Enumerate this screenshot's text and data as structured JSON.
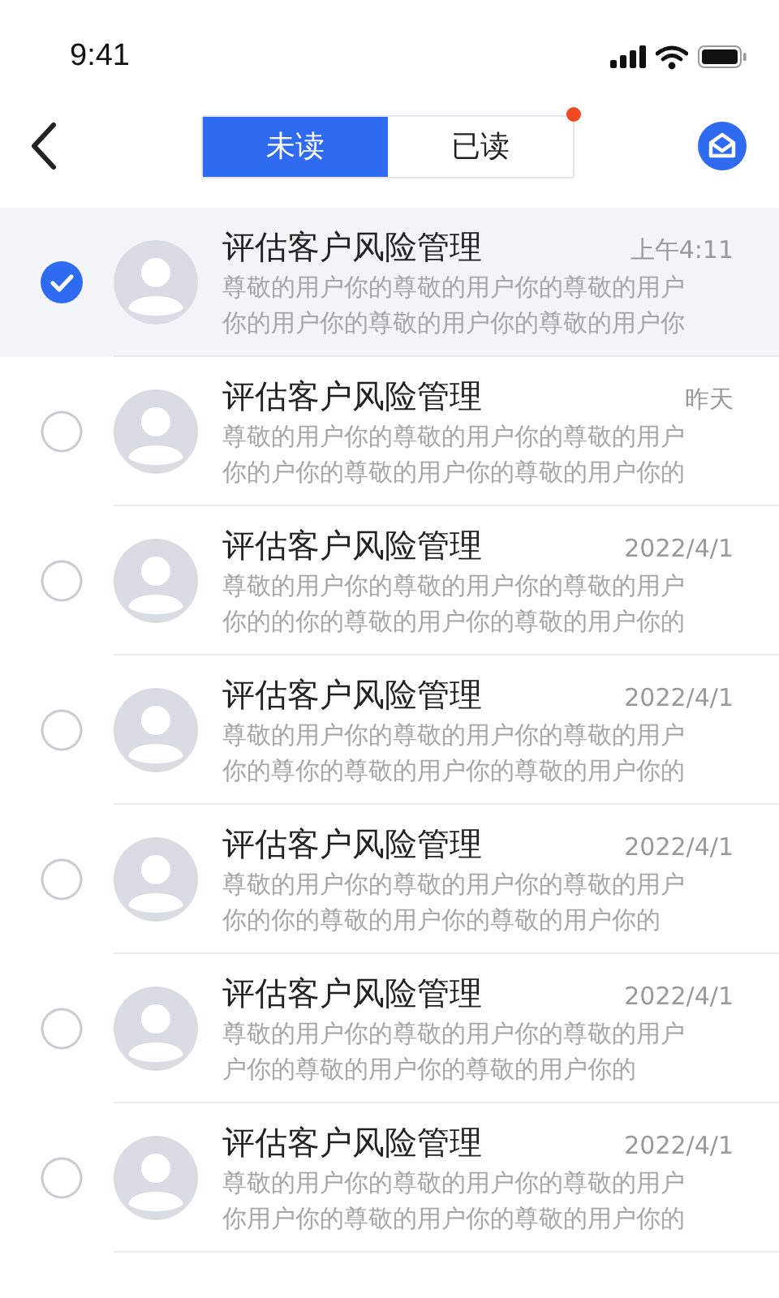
{
  "status_bar": {
    "time": "9:41"
  },
  "tabs": [
    {
      "label": "未读",
      "selected": true,
      "badge": false
    },
    {
      "label": "已读",
      "selected": false,
      "badge": true
    }
  ],
  "messages": [
    {
      "title": "评估客户风险管理",
      "time": "上午4:11",
      "line1": "尊敬的用户你的尊敬的用户你的尊敬的用户",
      "line2": "你的用户你的尊敬的用户你的尊敬的用户你",
      "checked": true
    },
    {
      "title": "评估客户风险管理",
      "time": "昨天",
      "line1": "尊敬的用户你的尊敬的用户你的尊敬的用户",
      "line2": "你的户你的尊敬的用户你的尊敬的用户你的",
      "checked": false
    },
    {
      "title": "评估客户风险管理",
      "time": "2022/4/1",
      "line1": "尊敬的用户你的尊敬的用户你的尊敬的用户",
      "line2": "你的的你的尊敬的用户你的尊敬的用户你的",
      "checked": false
    },
    {
      "title": "评估客户风险管理",
      "time": "2022/4/1",
      "line1": "尊敬的用户你的尊敬的用户你的尊敬的用户",
      "line2": "你的尊你的尊敬的用户你的尊敬的用户你的",
      "checked": false
    },
    {
      "title": "评估客户风险管理",
      "time": "2022/4/1",
      "line1": "尊敬的用户你的尊敬的用户你的尊敬的用户",
      "line2": "你的你的尊敬的用户你的尊敬的用户你的",
      "checked": false
    },
    {
      "title": "评估客户风险管理",
      "time": "2022/4/1",
      "line1": "尊敬的用户你的尊敬的用户你的尊敬的用户",
      "line2": "户你的尊敬的用户你的尊敬的用户你的",
      "checked": false
    },
    {
      "title": "评估客户风险管理",
      "time": "2022/4/1",
      "line1": "尊敬的用户你的尊敬的用户你的尊敬的用户",
      "line2": "你用户你的尊敬的用户你的尊敬的用户你的",
      "checked": false
    }
  ]
}
